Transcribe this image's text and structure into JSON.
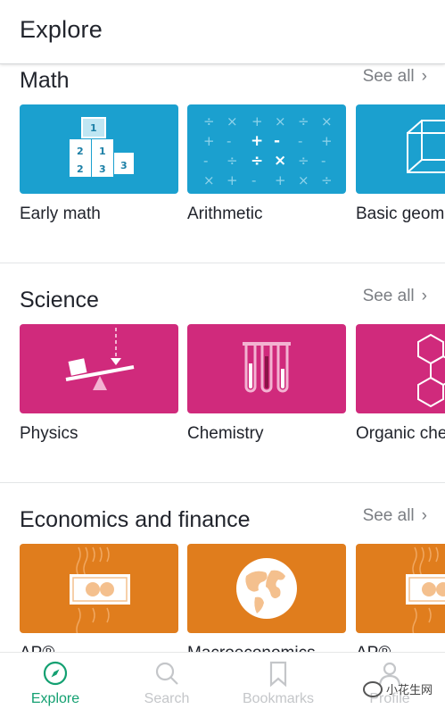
{
  "app_bar": {
    "title": "Explore"
  },
  "sections": [
    {
      "title": "Math",
      "see_all": "See all",
      "cards": [
        {
          "label": "Early math",
          "icon": "number-blocks-icon"
        },
        {
          "label": "Arithmetic",
          "icon": "arithmetic-symbols-icon"
        },
        {
          "label": "Basic geometry",
          "icon": "cube-icon"
        }
      ]
    },
    {
      "title": "Science",
      "see_all": "See all",
      "cards": [
        {
          "label": "Physics",
          "icon": "seesaw-icon"
        },
        {
          "label": "Chemistry",
          "icon": "test-tubes-icon"
        },
        {
          "label": "Organic chemistry",
          "icon": "hexagon-molecule-icon"
        }
      ]
    },
    {
      "title": "Economics and finance",
      "see_all": "See all",
      "cards": [
        {
          "label": "AP®",
          "icon": "banknote-icon"
        },
        {
          "label": "Macroeconomics",
          "icon": "globe-icon"
        },
        {
          "label": "AP®",
          "icon": "banknote-icon"
        }
      ]
    }
  ],
  "bottom_nav": [
    {
      "label": "Explore",
      "icon": "compass-icon",
      "active": true
    },
    {
      "label": "Search",
      "icon": "search-icon",
      "active": false
    },
    {
      "label": "Bookmarks",
      "icon": "bookmark-icon",
      "active": false
    },
    {
      "label": "Profile",
      "icon": "person-icon",
      "active": false
    }
  ],
  "watermark": {
    "text": "小花生网"
  },
  "colors": {
    "math": "#1ba0cf",
    "science": "#d02a7c",
    "economics": "#e07d1d",
    "active_nav": "#13a071",
    "inactive_nav": "#c4c6c9"
  }
}
